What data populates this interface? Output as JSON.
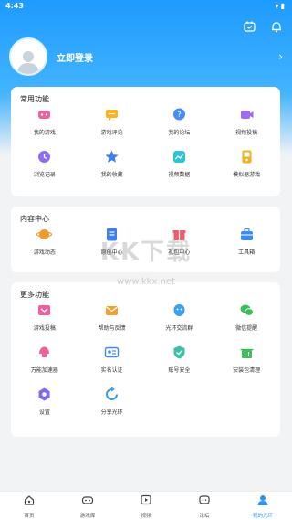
{
  "status_bar": {
    "time": "4:43"
  },
  "header": {
    "login_label": "立即登录"
  },
  "sections": [
    {
      "title": "常用功能",
      "items": [
        {
          "label": "我的游戏",
          "icon": "game-icon",
          "color": "#f0609a"
        },
        {
          "label": "游戏评论",
          "icon": "comment-icon",
          "color": "#ffb21e"
        },
        {
          "label": "我的论坛",
          "icon": "forum-icon",
          "color": "#4a8cf6"
        },
        {
          "label": "视频投稿",
          "icon": "video-upload-icon",
          "color": "#9d6cf2"
        },
        {
          "label": "浏览记录",
          "icon": "history-icon",
          "color": "#8b6cf2"
        },
        {
          "label": "我的收藏",
          "icon": "star-icon",
          "color": "#3c7ff0"
        },
        {
          "label": "视频数据",
          "icon": "chart-icon",
          "color": "#2bc4d8"
        },
        {
          "label": "模拟器游戏",
          "icon": "emulator-icon",
          "color": "#f2b21e"
        }
      ]
    },
    {
      "title": "内容中心",
      "items": [
        {
          "label": "游戏动态",
          "icon": "planet-icon",
          "color": "#f29a2e"
        },
        {
          "label": "原创中心",
          "icon": "document-icon",
          "color": "#3c7ff0"
        },
        {
          "label": "礼包中心",
          "icon": "gift-icon",
          "color": "#f05c6c"
        },
        {
          "label": "工具箱",
          "icon": "toolbox-icon",
          "color": "#3a8cf0"
        }
      ]
    },
    {
      "title": "更多功能",
      "items": [
        {
          "label": "游戏投稿",
          "icon": "game-submit-icon",
          "color": "#f0609a"
        },
        {
          "label": "帮助与反馈",
          "icon": "help-icon",
          "color": "#f2a02e"
        },
        {
          "label": "光环交流群",
          "icon": "chat-group-icon",
          "color": "#3aa0f0"
        },
        {
          "label": "微信提醒",
          "icon": "wechat-icon",
          "color": "#3cbf5a"
        },
        {
          "label": "万能加速器",
          "icon": "accelerator-icon",
          "color": "#f0609a"
        },
        {
          "label": "实名认证",
          "icon": "id-card-icon",
          "color": "#3a8cf0"
        },
        {
          "label": "账号安全",
          "icon": "shield-icon",
          "color": "#3cc0a8"
        },
        {
          "label": "安装包清理",
          "icon": "cleaner-icon",
          "color": "#3cbf5a"
        },
        {
          "label": "设置",
          "icon": "gear-icon",
          "color": "#7a6cf2"
        },
        {
          "label": "分享光环",
          "icon": "share-icon",
          "color": "#3a9cf0"
        }
      ]
    }
  ],
  "watermark": {
    "text": "KK下载",
    "url": "www.kkx.net"
  },
  "tabbar": [
    {
      "label": "首页",
      "icon": "home-icon"
    },
    {
      "label": "游戏库",
      "icon": "gamepad-icon"
    },
    {
      "label": "视频",
      "icon": "play-icon"
    },
    {
      "label": "论坛",
      "icon": "forum-tab-icon"
    },
    {
      "label": "我的光环",
      "icon": "me-icon"
    }
  ],
  "colors": {
    "accent": "#2c96f0",
    "header_blue": "#1e9bff"
  }
}
